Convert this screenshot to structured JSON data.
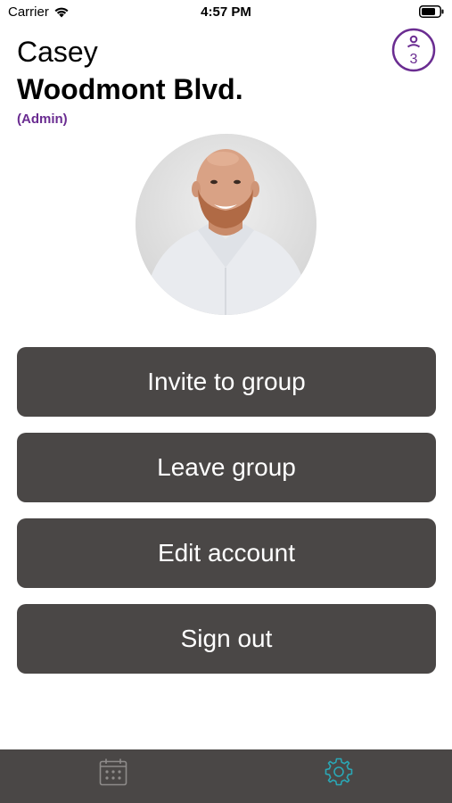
{
  "status_bar": {
    "carrier": "Carrier",
    "time": "4:57 PM"
  },
  "header": {
    "user_name": "Casey",
    "group_name": "Woodmont Blvd.",
    "role": "(Admin)",
    "group_member_count": "3",
    "accent_color": "#6a2c91"
  },
  "avatar": {
    "alt": "profile photo"
  },
  "actions": [
    {
      "label": "Invite to group"
    },
    {
      "label": "Leave group"
    },
    {
      "label": "Edit account"
    },
    {
      "label": "Sign out"
    }
  ],
  "tab_bar": {
    "tabs": [
      {
        "icon": "calendar-icon",
        "active": false
      },
      {
        "icon": "gear-icon",
        "active": true
      }
    ],
    "active_color": "#2aa7b5"
  }
}
